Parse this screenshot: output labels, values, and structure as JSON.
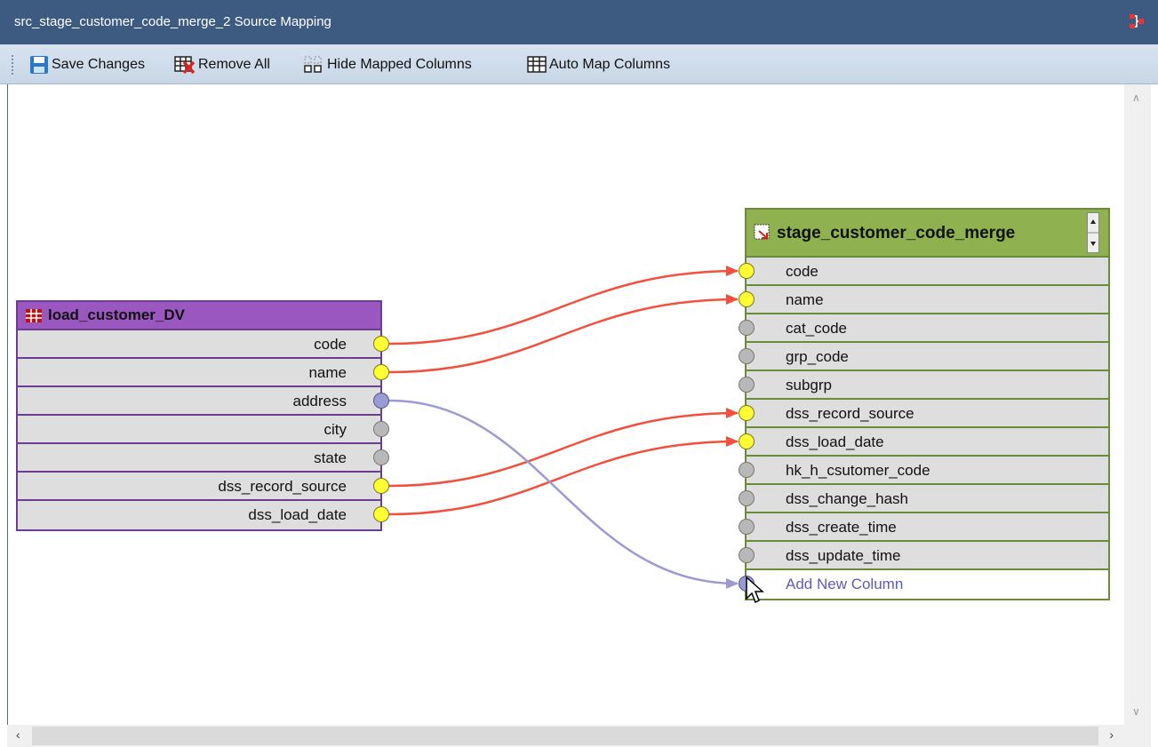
{
  "window": {
    "title": "src_stage_customer_code_merge_2 Source Mapping",
    "app_icon": "mapping-icon"
  },
  "toolbar": {
    "save_label": "Save Changes",
    "remove_all_label": "Remove All",
    "hide_mapped_label": "Hide Mapped Columns",
    "auto_map_label": "Auto Map Columns"
  },
  "source_table": {
    "name": "load_customer_DV",
    "columns": [
      {
        "name": "code",
        "mapped": true
      },
      {
        "name": "name",
        "mapped": true
      },
      {
        "name": "address",
        "mapped": true
      },
      {
        "name": "city",
        "mapped": false
      },
      {
        "name": "state",
        "mapped": false
      },
      {
        "name": "dss_record_source",
        "mapped": true
      },
      {
        "name": "dss_load_date",
        "mapped": true
      }
    ]
  },
  "target_table": {
    "name": "stage_customer_code_merge",
    "columns": [
      {
        "name": "code",
        "mapped": true
      },
      {
        "name": "name",
        "mapped": true
      },
      {
        "name": "cat_code",
        "mapped": false
      },
      {
        "name": "grp_code",
        "mapped": false
      },
      {
        "name": "subgrp",
        "mapped": false
      },
      {
        "name": "dss_record_source",
        "mapped": true
      },
      {
        "name": "dss_load_date",
        "mapped": true
      },
      {
        "name": "hk_h_csutomer_code",
        "mapped": false
      },
      {
        "name": "dss_change_hash",
        "mapped": false
      },
      {
        "name": "dss_create_time",
        "mapped": false
      },
      {
        "name": "dss_update_time",
        "mapped": false
      }
    ],
    "add_new_label": "Add New Column"
  },
  "mappings": [
    {
      "from": "code",
      "to": "code",
      "color": "#f0503c"
    },
    {
      "from": "name",
      "to": "name",
      "color": "#f0503c"
    },
    {
      "from": "dss_record_source",
      "to": "dss_record_source",
      "color": "#f0503c"
    },
    {
      "from": "dss_load_date",
      "to": "dss_load_date",
      "color": "#f0503c"
    },
    {
      "from": "address",
      "to": "Add New Column",
      "color": "#9a9ad4"
    }
  ]
}
